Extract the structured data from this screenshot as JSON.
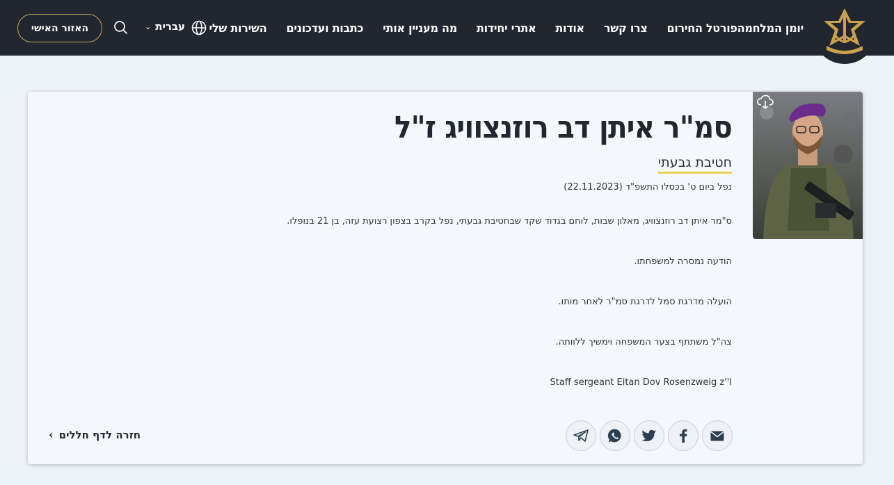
{
  "header": {
    "logo_alt": "IDF emblem",
    "nav": [
      "השירות שלי",
      "כתבות ועדכונים",
      "מה מעניין אותי",
      "אתרי יחידות",
      "אודות",
      "צרו קשר",
      "פורטל החירום",
      "יומן המלחמה"
    ],
    "language": "עברית",
    "personal_area": "האזור האישי"
  },
  "profile": {
    "name": "סמ\"ר איתן דב רוזנצוויג ז\"ל",
    "unit": "חטיבת גבעתי",
    "fell_date": "נפל ביום ט' בכסלו התשפ\"ד (22.11.2023)",
    "paragraphs": [
      "ס\"מר איתן דב רוזנצוויג, מאלון שבות, לוחם בגדוד שקד שבחטיבת גבעתי, נפל בקרב בצפון רצועת עזה, בן 21 בנופלו.",
      "הודעה נמסרה למשפחתו.",
      "הועלה מדרגת סמל לדרגת סמ\"ר לאחר מותו.",
      "צה\"ל משתתף בצער המשפחה וימשיך ללוותה."
    ],
    "english_name": "Staff sergeant Eitan Dov Rosenzweig z''l"
  },
  "share_icons": [
    "telegram-icon",
    "whatsapp-icon",
    "twitter-icon",
    "facebook-icon",
    "email-icon"
  ],
  "back_link": "חזרה לדף חללים",
  "colors": {
    "header_bg": "#22262f",
    "accent_gold": "#c6a960",
    "underline_yellow": "#f0cf54",
    "page_bg": "#eef3f8"
  }
}
